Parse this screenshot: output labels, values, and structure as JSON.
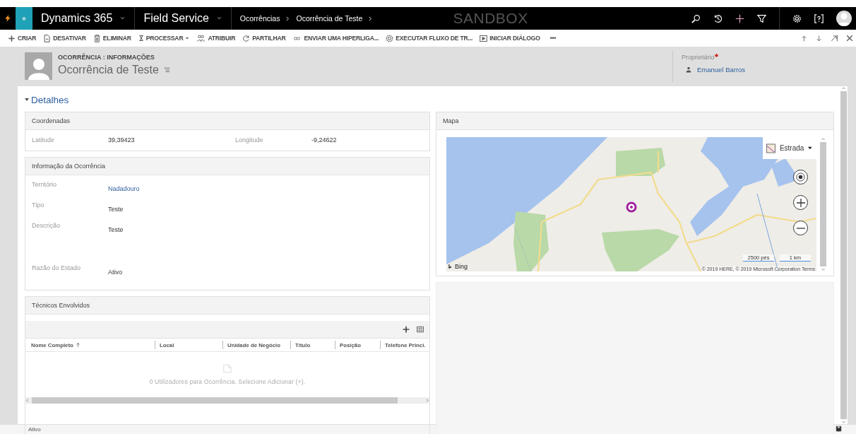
{
  "nav": {
    "app_name": "Dynamics 365",
    "module": "Field Service",
    "breadcrumbs": [
      "Ocorrências",
      "Ocorrência de Teste"
    ],
    "environment": "SANDBOX"
  },
  "commands": [
    {
      "label": "CRIAR",
      "dropdown": false
    },
    {
      "label": "DESATIVAR",
      "dropdown": false
    },
    {
      "label": "ELIMINAR",
      "dropdown": false
    },
    {
      "label": "PROCESSAR",
      "dropdown": true
    },
    {
      "label": "ATRIBUIR",
      "dropdown": false
    },
    {
      "label": "PARTILHAR",
      "dropdown": false
    },
    {
      "label": "ENVIAR UMA HIPERLIGA...",
      "dropdown": false
    },
    {
      "label": "EXECUTAR FLUXO DE TR...",
      "dropdown": false
    },
    {
      "label": "INICIAR DIÁLOGO",
      "dropdown": false
    }
  ],
  "more": "•••",
  "header": {
    "entity": "OCORRÊNCIA : INFORMAÇÕES",
    "title": "Ocorrência de Teste",
    "owner_label": "Proprietário",
    "owner_required": true,
    "owner": "Emanuel Barros"
  },
  "tab": {
    "title": "Detalhes",
    "expanded": true
  },
  "coordinates": {
    "title": "Coordenadas",
    "fields": [
      {
        "label": "Latitude",
        "value": "39,39423"
      },
      {
        "label": "Longitude",
        "value": "-9,24622"
      }
    ]
  },
  "info": {
    "title": "Informação da Ocorrência",
    "fields": [
      {
        "label": "Território",
        "value": "Nadadouro",
        "kind": "link"
      },
      {
        "label": "Tipo",
        "value": "Teste",
        "kind": "text"
      },
      {
        "label": "Descrição",
        "value": "Teste",
        "kind": "multiline"
      },
      {
        "label": "Razão do Estado",
        "value": "Ativo",
        "kind": "text"
      }
    ]
  },
  "technicians": {
    "title": "Técnicos Envolvidos",
    "columns": [
      {
        "label": "Nome Completo",
        "sorted": true
      },
      {
        "label": "Local",
        "sorted": false
      },
      {
        "label": "Unidade de Negócio",
        "sorted": false
      },
      {
        "label": "Título",
        "sorted": false
      },
      {
        "label": "Posição",
        "sorted": false
      },
      {
        "label": "Telefone Princi.",
        "sorted": false
      }
    ],
    "empty_message": "0 Utilizadores para Ocorrência. Selecione Adicionar (+)."
  },
  "map": {
    "title": "Mapa",
    "style": "Estrada",
    "brand": "Bing",
    "scale": [
      "2500 pés",
      "1 km"
    ],
    "copyright": "© 2019 HERE, © 2019 Microsoft Corporation Terms"
  },
  "status_bar": {
    "status": "Ativo"
  }
}
